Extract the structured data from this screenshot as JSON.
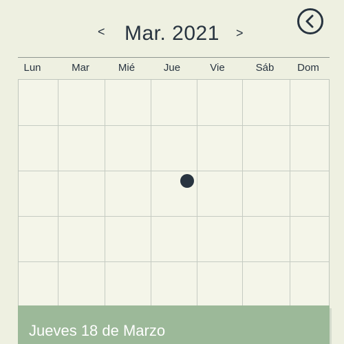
{
  "header": {
    "month_label": "Mar. 2021",
    "prev_label": "<",
    "next_label": ">"
  },
  "weekdays": [
    "Lun",
    "Mar",
    "Mié",
    "Jue",
    "Vie",
    "Sáb",
    "Dom"
  ],
  "selected_date": {
    "label": "Jueves 18 de Marzo"
  },
  "icons": {
    "back": "chevron-left-circle-icon",
    "event_marker": "dot-icon"
  },
  "colors": {
    "background": "#eef0e1",
    "grid_background": "#f4f5e9",
    "text": "#283440",
    "accent": "#9cb999"
  }
}
